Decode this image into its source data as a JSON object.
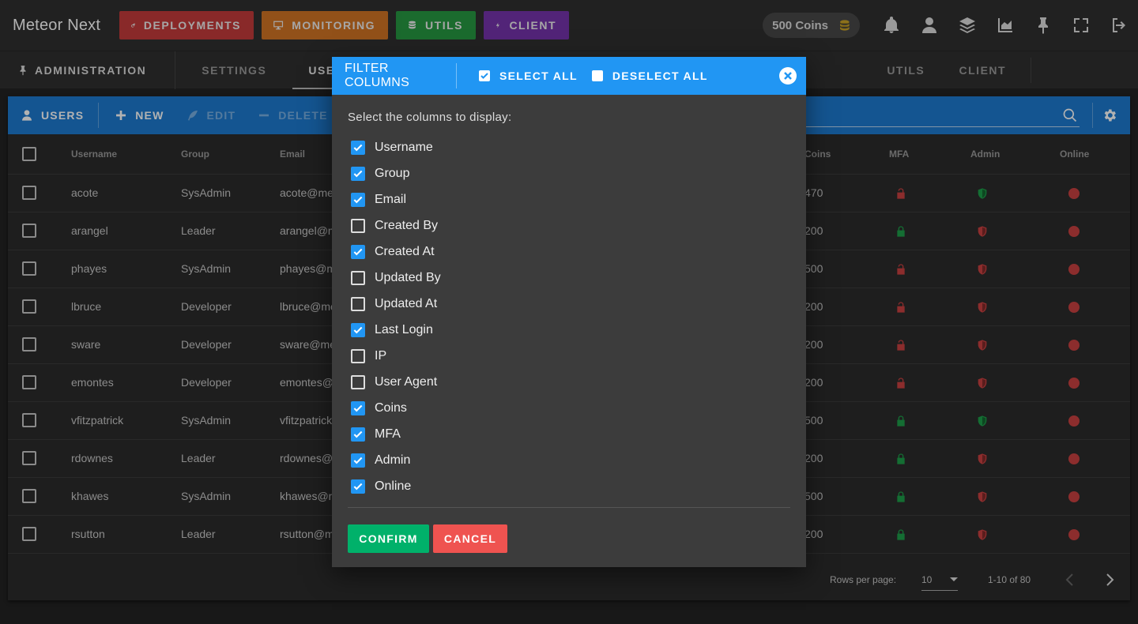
{
  "app": {
    "title": "Meteor Next"
  },
  "nav": {
    "deployments": "DEPLOYMENTS",
    "monitoring": "MONITORING",
    "utils": "UTILS",
    "client": "CLIENT"
  },
  "coins": {
    "label": "500 Coins"
  },
  "tabs": {
    "admin": "ADMINISTRATION",
    "items": [
      "SETTINGS",
      "USERS",
      "UTILS",
      "CLIENT"
    ]
  },
  "toolbar": {
    "users": "USERS",
    "new": "NEW",
    "edit": "EDIT",
    "delete": "DELETE"
  },
  "table": {
    "headers": {
      "username": "Username",
      "group": "Group",
      "email": "Email",
      "coins": "Coins",
      "mfa": "MFA",
      "admin": "Admin",
      "online": "Online"
    },
    "rows": [
      {
        "username": "acote",
        "group": "SysAdmin",
        "email": "acote@me",
        "coins": "470",
        "mfa": false,
        "admin": true
      },
      {
        "username": "arangel",
        "group": "Leader",
        "email": "arangel@m",
        "coins": "200",
        "mfa": true,
        "admin": false
      },
      {
        "username": "phayes",
        "group": "SysAdmin",
        "email": "phayes@m",
        "coins": "500",
        "mfa": false,
        "admin": false
      },
      {
        "username": "lbruce",
        "group": "Developer",
        "email": "lbruce@me",
        "coins": "200",
        "mfa": false,
        "admin": false
      },
      {
        "username": "sware",
        "group": "Developer",
        "email": "sware@me",
        "coins": "200",
        "mfa": false,
        "admin": false
      },
      {
        "username": "emontes",
        "group": "Developer",
        "email": "emontes@",
        "coins": "200",
        "mfa": false,
        "admin": false
      },
      {
        "username": "vfitzpatrick",
        "group": "SysAdmin",
        "email": "vfitzpatrick",
        "coins": "500",
        "mfa": true,
        "admin": true
      },
      {
        "username": "rdownes",
        "group": "Leader",
        "email": "rdownes@",
        "coins": "200",
        "mfa": true,
        "admin": false
      },
      {
        "username": "khawes",
        "group": "SysAdmin",
        "email": "khawes@m",
        "coins": "500",
        "mfa": true,
        "admin": false
      },
      {
        "username": "rsutton",
        "group": "Leader",
        "email": "rsutton@m",
        "coins": "200",
        "mfa": true,
        "admin": false
      }
    ]
  },
  "pagination": {
    "rows_label": "Rows per page:",
    "rows_value": "10",
    "range": "1-10 of 80"
  },
  "dialog": {
    "title": "FILTER COLUMNS",
    "select_all": "SELECT ALL",
    "deselect_all": "DESELECT ALL",
    "subtitle": "Select the columns to display:",
    "columns": [
      {
        "label": "Username",
        "checked": true
      },
      {
        "label": "Group",
        "checked": true
      },
      {
        "label": "Email",
        "checked": true
      },
      {
        "label": "Created By",
        "checked": false
      },
      {
        "label": "Created At",
        "checked": true
      },
      {
        "label": "Updated By",
        "checked": false
      },
      {
        "label": "Updated At",
        "checked": false
      },
      {
        "label": "Last Login",
        "checked": true
      },
      {
        "label": "IP",
        "checked": false
      },
      {
        "label": "User Agent",
        "checked": false
      },
      {
        "label": "Coins",
        "checked": true
      },
      {
        "label": "MFA",
        "checked": true
      },
      {
        "label": "Admin",
        "checked": true
      },
      {
        "label": "Online",
        "checked": true
      }
    ],
    "confirm": "CONFIRM",
    "cancel": "CANCEL"
  },
  "colors": {
    "red": "#c94141",
    "green": "#1e9e4a",
    "blue": "#2196f3",
    "toolbar_blue": "#1e7ad0"
  }
}
